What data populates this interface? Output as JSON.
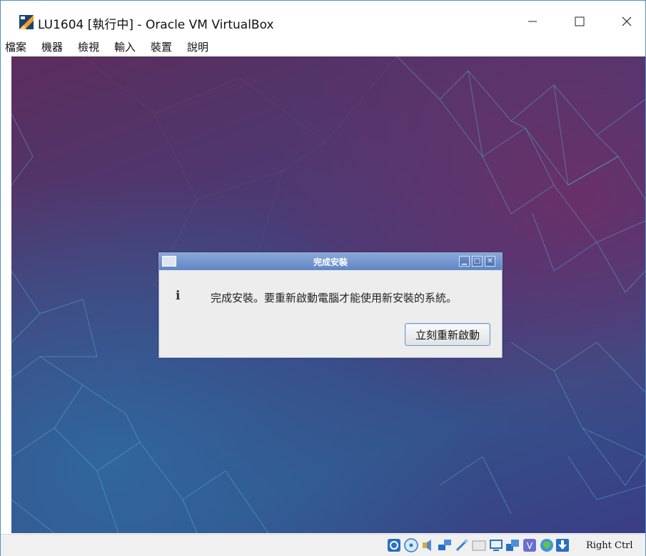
{
  "window": {
    "title": "LU1604 [執行中] - Oracle VM VirtualBox",
    "app_icon": "virtualbox-icon",
    "controls": [
      "minimize-icon",
      "maximize-icon",
      "close-icon"
    ]
  },
  "menubar": {
    "items": [
      {
        "label": "檔案"
      },
      {
        "label": "機器"
      },
      {
        "label": "檢視"
      },
      {
        "label": "輸入"
      },
      {
        "label": "裝置"
      },
      {
        "label": "說明"
      }
    ]
  },
  "dialog": {
    "title": "完成安裝",
    "icon": "info-icon",
    "info_glyph": "i",
    "message": "完成安裝。要重新啟動電腦才能使用新安裝的系統。",
    "button_label": "立刻重新啟動"
  },
  "statusbar": {
    "icons": [
      "hard-disk-icon",
      "optical-disk-icon",
      "audio-icon",
      "network-icon",
      "usb-icon",
      "shared-folder-icon",
      "display-icon",
      "video-capture-icon",
      "virtualization-icon",
      "mouse-integration-icon",
      "keyboard-capture-icon"
    ],
    "host_key": "Right Ctrl"
  },
  "colors": {
    "window_border": "#4a90c8",
    "dialog_title": "#6b8fcc",
    "desktop_purple": "#5b2d5c",
    "desktop_blue": "#35508a"
  }
}
